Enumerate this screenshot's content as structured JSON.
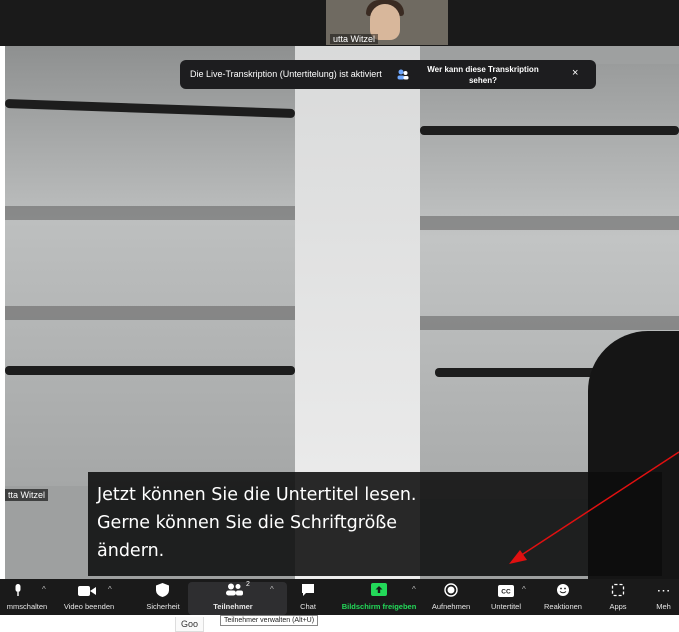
{
  "thumbnail": {
    "name": "utta Witzel"
  },
  "speaker_tag": "tta Witzel",
  "banner": {
    "message": "Die Live-Transkription (Untertitelung) ist aktiviert",
    "link": "Wer kann diese Transkription sehen?",
    "close": "×"
  },
  "caption": {
    "line1": "Jetzt können Sie die Untertitel lesen.",
    "line2": "Gerne können Sie die Schriftgröße",
    "line3": "ändern."
  },
  "toolbar": {
    "mute": "mmschalten",
    "video": "Video beenden",
    "security": "Sicherheit",
    "participants": "Teilnehmer",
    "participants_count": "2",
    "chat": "Chat",
    "share": "Bildschirm freigeben",
    "record": "Aufnehmen",
    "subtitles": "Untertitel",
    "reactions": "Reaktionen",
    "apps": "Apps",
    "more": "Meh"
  },
  "tooltip": "Teilnehmer verwalten (Alt+U)",
  "taskbar_snippet": "Goo",
  "colors": {
    "share_green": "#23d959",
    "arrow_red": "#e01010"
  }
}
